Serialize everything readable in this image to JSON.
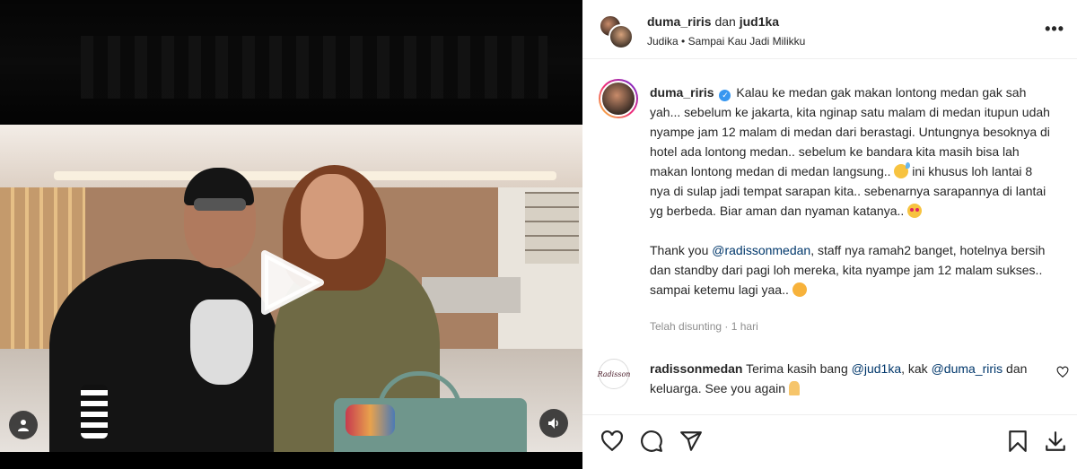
{
  "post": {
    "header": {
      "user1": "duma_riris",
      "joiner": "dan",
      "user2": "jud1ka",
      "artist": "Judika",
      "separator": "•",
      "song": "Sampai Kau Jadi Milikku"
    },
    "caption": {
      "username": "duma_riris",
      "verified_mark": "✓",
      "text_a": "Kalau ke medan gak makan lontong medan gak sah yah... sebelum ke jakarta, kita nginap satu malam di medan itupun udah nyampe jam 12 malam di medan dari berastagi. Untungnya besoknya di hotel ada lontong medan.. sebelum ke bandara kita masih bisa lah makan lontong medan di medan langsung..",
      "text_b": "ini khusus loh lantai 8 nya di sulap jadi tempat sarapan kita.. sebenarnya sarapannya di lantai yg berbeda. Biar aman dan nyaman katanya..",
      "p2_a": "Thank you",
      "p2_mention": "@radissonmedan",
      "p2_b": ", staff nya ramah2 banget, hotelnya bersih dan standby dari pagi loh mereka, kita nyampe jam 12 malam sukses.. sampai ketemu lagi yaa..",
      "edited": "Telah disunting · 1 hari"
    },
    "comment": {
      "avatar_text": "Radisson",
      "username": "radissonmedan",
      "text_a": "Terima kasih bang",
      "mention1": "@jud1ka",
      "text_b": ", kak",
      "mention2": "@duma_riris",
      "text_c": "dan keluarga. See you again"
    },
    "more_label": "•••"
  },
  "icons": [
    "play-icon",
    "user-icon",
    "volume-icon",
    "heart-icon",
    "comment-icon",
    "share-icon",
    "bookmark-icon",
    "download-icon"
  ],
  "colors": {
    "mention": "#00376b",
    "verified": "#3897f0",
    "muted": "#8e8e8e",
    "text": "#262626"
  }
}
